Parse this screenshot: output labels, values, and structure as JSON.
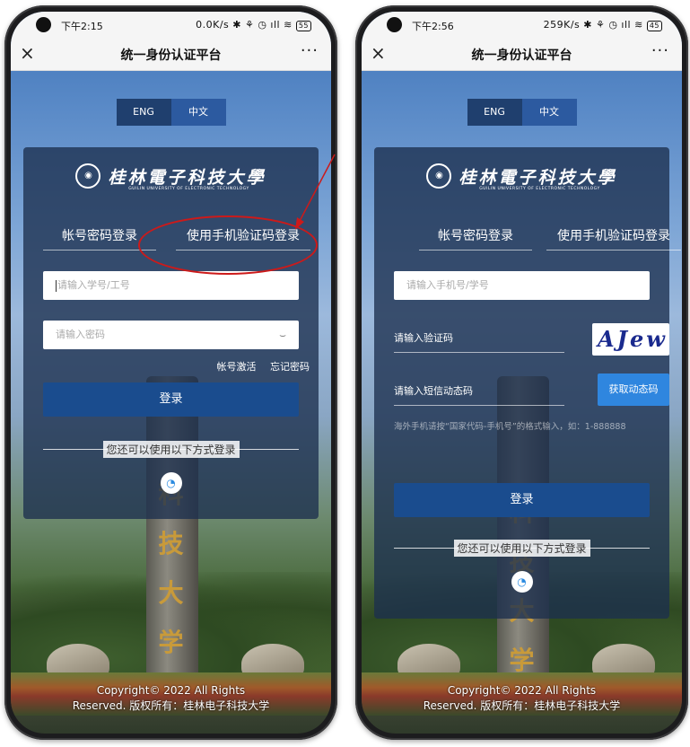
{
  "left": {
    "status": {
      "time": "下午2:15",
      "net": "0.0K/s",
      "battery": "55"
    },
    "nav": {
      "close": "×",
      "title": "统一身份认证平台",
      "more": "···"
    },
    "lang": {
      "eng": "ENG",
      "zh": "中文"
    },
    "logo": {
      "cn": "桂林電子科技大學",
      "en": "GUILIN UNIVERSITY OF ELECTRONIC TECHNOLOGY"
    },
    "tabs": {
      "account": "帐号密码登录",
      "phone": "使用手机验证码登录"
    },
    "fields": {
      "user_placeholder": "请输入学号/工号",
      "password_placeholder": "请输入密码"
    },
    "links": {
      "activate": "帐号激活",
      "forgot": "忘记密码"
    },
    "login": "登录",
    "alt_login": "您还可以使用以下方式登录",
    "copyright": [
      "Copyright© 2022 All Rights",
      "Reserved. 版权所有：桂林电子科技大学"
    ]
  },
  "right": {
    "status": {
      "time": "下午2:56",
      "net": "259K/s",
      "battery": "45"
    },
    "nav": {
      "close": "×",
      "title": "统一身份认证平台",
      "more": "···"
    },
    "lang": {
      "eng": "ENG",
      "zh": "中文"
    },
    "logo": {
      "cn": "桂林電子科技大學",
      "en": "GUILIN UNIVERSITY OF ELECTRONIC TECHNOLOGY"
    },
    "tabs": {
      "account": "帐号密码登录",
      "phone": "使用手机验证码登录"
    },
    "fields": {
      "phone_placeholder": "请输入手机号/学号",
      "captcha_placeholder": "请输入验证码",
      "sms_placeholder": "请输入短信动态码"
    },
    "captcha_text": "AJew",
    "sms_button": "获取动态码",
    "hint": "海外手机请按“国家代码-手机号”的格式输入，如：1-888888",
    "login": "登录",
    "alt_login": "您还可以使用以下方式登录",
    "copyright": [
      "Copyright© 2022 All Rights",
      "Reserved. 版权所有：桂林电子科技大学"
    ]
  },
  "stone_text": [
    "科",
    "技",
    "大",
    "学"
  ],
  "colors": {
    "card": "#1c304e",
    "primary_button": "#1a4c8e",
    "sms_button": "#2f86df",
    "annotation": "#cc1a1a"
  }
}
